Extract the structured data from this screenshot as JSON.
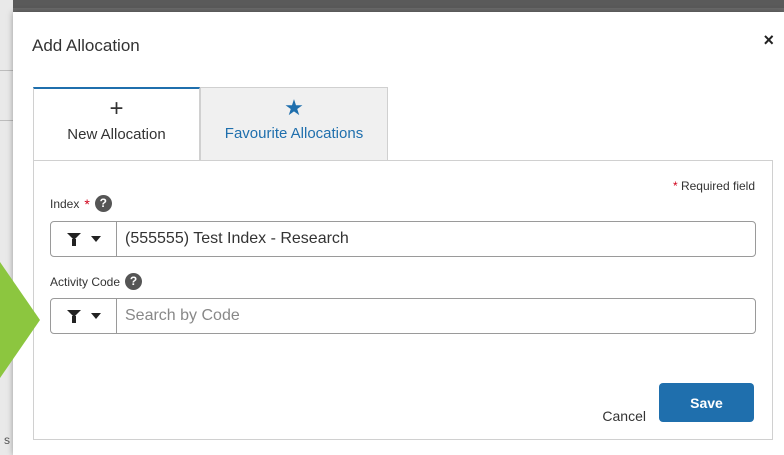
{
  "background": {
    "left_text": "s"
  },
  "modal": {
    "title": "Add Allocation",
    "close_icon": "×",
    "tabs": [
      {
        "icon": "+",
        "icon_name": "plus-icon",
        "label": "New Allocation",
        "active": true
      },
      {
        "icon": "★",
        "icon_name": "star-icon",
        "label": "Favourite Allocations",
        "active": false
      }
    ],
    "required_note": {
      "star": "*",
      "text": "Required field"
    },
    "fields": {
      "index": {
        "label": "Index",
        "required_star": "*",
        "help": "?",
        "value": "(555555) Test Index - Research"
      },
      "activity_code": {
        "label": "Activity Code",
        "help": "?",
        "value": "",
        "placeholder": "Search by Code"
      }
    },
    "buttons": {
      "cancel": "Cancel",
      "save": "Save"
    }
  },
  "colors": {
    "accent": "#1f6fad",
    "required": "#d0021b",
    "arrow": "#8cc63f"
  }
}
